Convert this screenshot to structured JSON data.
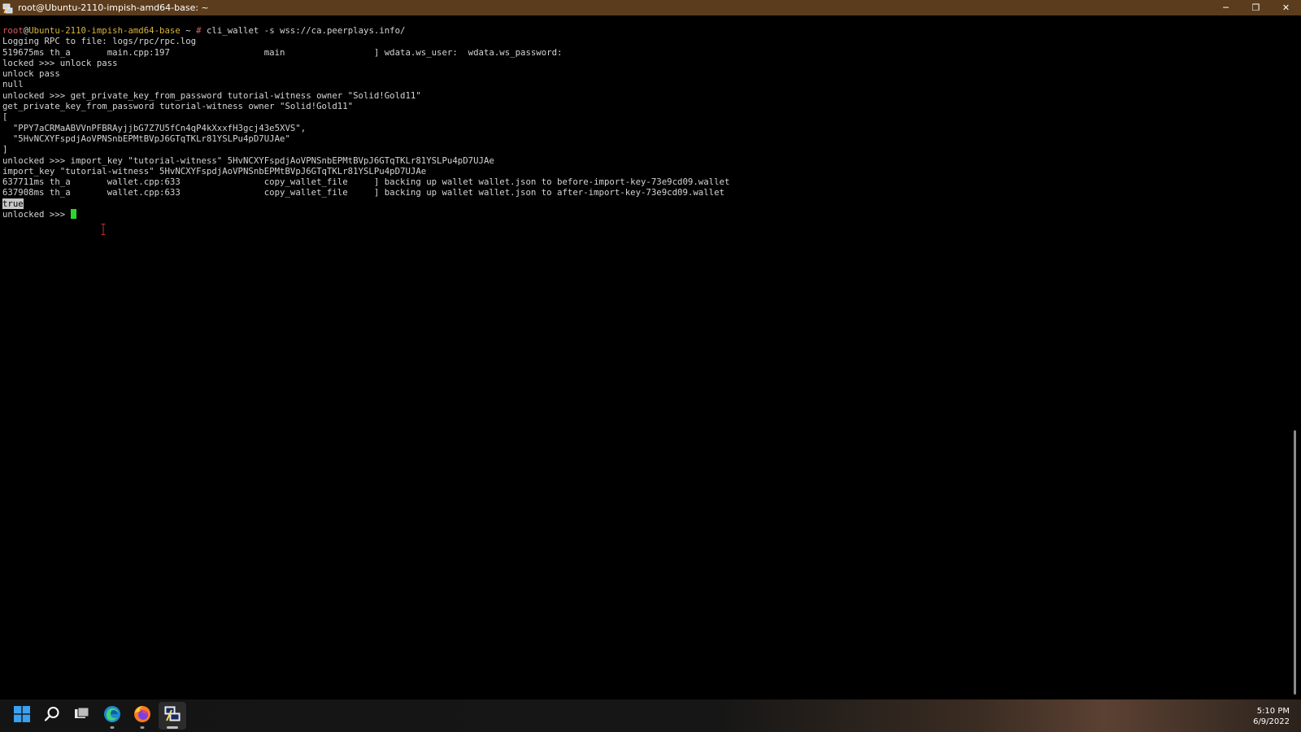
{
  "window": {
    "title": "root@Ubuntu-2110-impish-amd64-base: ~",
    "controls": {
      "minimize": "─",
      "maximize": "❐",
      "close": "✕"
    }
  },
  "terminal": {
    "prompt": {
      "user": "root",
      "at": "@",
      "host": "Ubuntu-2110-impish-amd64-base",
      "path": " ~ ",
      "symbol": "#",
      "command": " cli_wallet -s wss://ca.peerplays.info/"
    },
    "lines": [
      "Logging RPC to file: logs/rpc/rpc.log",
      "519675ms th_a       main.cpp:197                  main                 ] wdata.ws_user:  wdata.ws_password:",
      "locked >>> unlock pass",
      "unlock pass",
      "null",
      "unlocked >>> get_private_key_from_password tutorial-witness owner \"Solid!Gold11\"",
      "get_private_key_from_password tutorial-witness owner \"Solid!Gold11\"",
      "[",
      "  \"PPY7aCRMaABVVnPFBRAyjjbG7Z7U5fCn4qP4kXxxfH3gcj43e5XVS\",",
      "  \"5HvNCXYFspdjAoVPNSnbEPMtBVpJ6GTqTKLr81YSLPu4pD7UJAe\"",
      "]",
      "unlocked >>> import_key \"tutorial-witness\" 5HvNCXYFspdjAoVPNSnbEPMtBVpJ6GTqTKLr81YSLPu4pD7UJAe",
      "import_key \"tutorial-witness\" 5HvNCXYFspdjAoVPNSnbEPMtBVpJ6GTqTKLr81YSLPu4pD7UJAe",
      "637711ms th_a       wallet.cpp:633                copy_wallet_file     ] backing up wallet wallet.json to before-import-key-73e9cd09.wallet",
      "637908ms th_a       wallet.cpp:633                copy_wallet_file     ] backing up wallet wallet.json to after-import-key-73e9cd09.wallet"
    ],
    "result": "true",
    "current_prompt": "unlocked >>> "
  },
  "taskbar": {
    "items": [
      {
        "name": "start",
        "icon": "windows-start-icon"
      },
      {
        "name": "search",
        "icon": "search-icon"
      },
      {
        "name": "task-view",
        "icon": "task-view-icon"
      },
      {
        "name": "edge",
        "icon": "edge-browser-icon"
      },
      {
        "name": "firefox",
        "icon": "firefox-icon"
      },
      {
        "name": "putty",
        "icon": "putty-icon"
      }
    ],
    "clock": {
      "time": "5:10 PM",
      "date": "6/9/2022"
    }
  },
  "colors": {
    "titlebar": "#5b3c1c",
    "terminal_bg": "#000000",
    "terminal_fg": "#d4d4d4",
    "prompt_user": "#e05a5a",
    "prompt_host": "#d9b33c",
    "cursor": "#2bd62b"
  }
}
